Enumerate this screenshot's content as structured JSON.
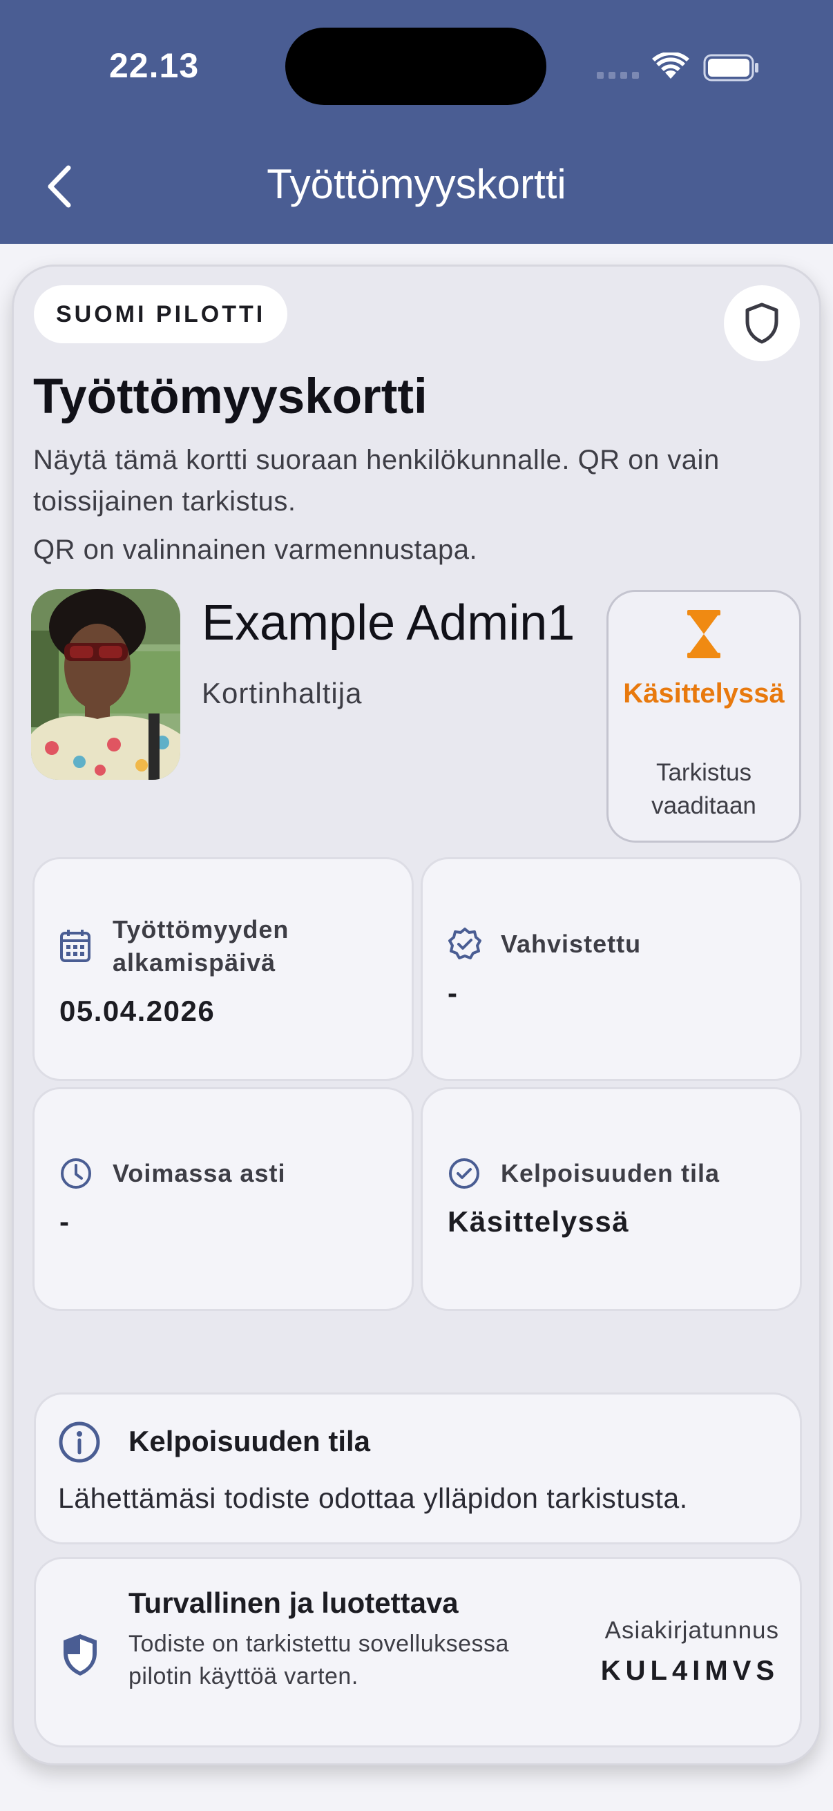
{
  "status_bar": {
    "time": "22.13",
    "wifi_icon": "wifi-icon",
    "battery_icon": "battery-icon"
  },
  "nav": {
    "back_icon": "chevron-left-icon",
    "title": "Työttömyyskortti"
  },
  "card": {
    "pilot_badge": "SUOMI PILOTTI",
    "shield_icon": "shield-icon",
    "title": "Työttömyyskortti",
    "description": "Näytä tämä kortti suoraan henkilökunnalle. QR on vain toissijainen tarkistus.",
    "qr_note": "QR on valinnainen varmennustapa.",
    "holder": {
      "name": "Example Admin1",
      "role": "Kortinhaltija"
    },
    "status": {
      "icon": "hourglass-icon",
      "label": "Käsittelyssä",
      "sublabel": "Tarkistus vaaditaan",
      "color": "#e8790d"
    },
    "tiles": [
      {
        "icon": "calendar-icon",
        "label": "Työttömyyden alkamispäivä",
        "value": "05.04.2026"
      },
      {
        "icon": "verified-badge-icon",
        "label": "Vahvistettu",
        "value": "-"
      },
      {
        "icon": "clock-icon",
        "label": "Voimassa asti",
        "value": "-"
      },
      {
        "icon": "check-circle-icon",
        "label": "Kelpoisuuden tila",
        "value": "Käsittelyssä"
      }
    ],
    "eligibility_info": {
      "icon": "info-icon",
      "title": "Kelpoisuuden tila",
      "text": "Lähettämäsi todiste odottaa ylläpidon tarkistusta."
    },
    "security": {
      "icon": "shield-half-icon",
      "title": "Turvallinen ja luotettava",
      "text": "Todiste on tarkistettu sovelluksessa pilotin käyttöä varten.",
      "doc_label": "Asiakirjatunnus",
      "doc_id": "KUL4IMVS"
    }
  },
  "colors": {
    "header": "#4a5d93",
    "accent": "#4a5d93",
    "status_orange": "#e8790d"
  }
}
